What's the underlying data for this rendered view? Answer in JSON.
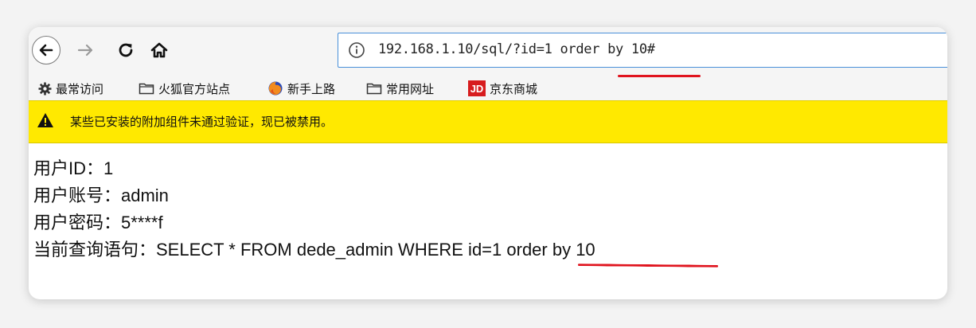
{
  "toolbar": {
    "url": "192.168.1.10/sql/?id=1 order by 10#"
  },
  "bookmarks": {
    "items": [
      {
        "label": "最常访问",
        "icon": "gear-icon"
      },
      {
        "label": "火狐官方站点",
        "icon": "folder-icon"
      },
      {
        "label": "新手上路",
        "icon": "firefox-icon"
      },
      {
        "label": "常用网址",
        "icon": "folder-icon"
      },
      {
        "label": "京东商城",
        "icon": "jd-logo-icon",
        "logo_text": "JD"
      }
    ]
  },
  "warning": {
    "text": "某些已安装的附加组件未通过验证，现已被禁用。"
  },
  "content": {
    "lines": [
      "用户ID：1",
      "用户账号：admin",
      "用户密码：5****f",
      "当前查询语句：SELECT * FROM dede_admin WHERE id=1 order by 10"
    ]
  },
  "colors": {
    "warning_bg": "#ffe900",
    "annotation": "#e0141e",
    "urlbar_border": "#4a90d9"
  }
}
